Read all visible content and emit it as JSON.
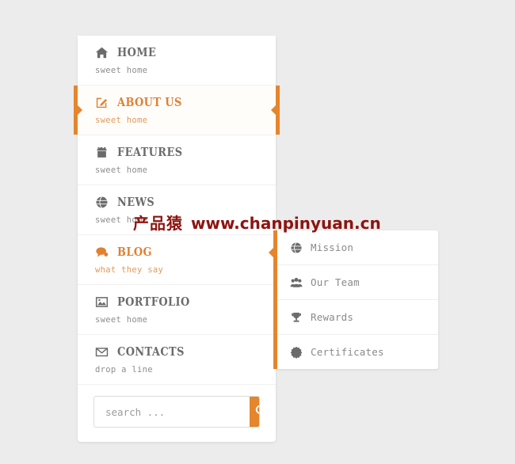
{
  "page": {
    "background_color": "#ececec",
    "accent_color": "#e5852c",
    "text_color": "#6b6b6b",
    "muted_color": "#8d8d8d"
  },
  "watermark": {
    "cn": "产品猿",
    "url": "www.chanpinyuan.cn",
    "color": "#8c1410"
  },
  "menu": {
    "items": [
      {
        "label": "HOME",
        "subtitle": "sweet home",
        "icon": "home-icon",
        "state": "default"
      },
      {
        "label": "ABOUT US",
        "subtitle": "sweet home",
        "icon": "edit-icon",
        "state": "active"
      },
      {
        "label": "FEATURES",
        "subtitle": "sweet home",
        "icon": "gift-icon",
        "state": "default"
      },
      {
        "label": "NEWS",
        "subtitle": "sweet home",
        "icon": "globe-icon",
        "state": "default"
      },
      {
        "label": "BLOG",
        "subtitle": "what they say",
        "icon": "comment-icon",
        "state": "hover"
      },
      {
        "label": "PORTFOLIO",
        "subtitle": "sweet home",
        "icon": "image-icon",
        "state": "default"
      },
      {
        "label": "CONTACTS",
        "subtitle": "drop a line",
        "icon": "envelope-icon",
        "state": "default"
      }
    ]
  },
  "search": {
    "value": "",
    "placeholder": "search ...",
    "button_icon": "search-icon"
  },
  "submenu": {
    "items": [
      {
        "label": "Mission",
        "icon": "globe-icon"
      },
      {
        "label": "Our Team",
        "icon": "users-icon"
      },
      {
        "label": "Rewards",
        "icon": "trophy-icon"
      },
      {
        "label": "Certificates",
        "icon": "badge-icon"
      }
    ]
  }
}
